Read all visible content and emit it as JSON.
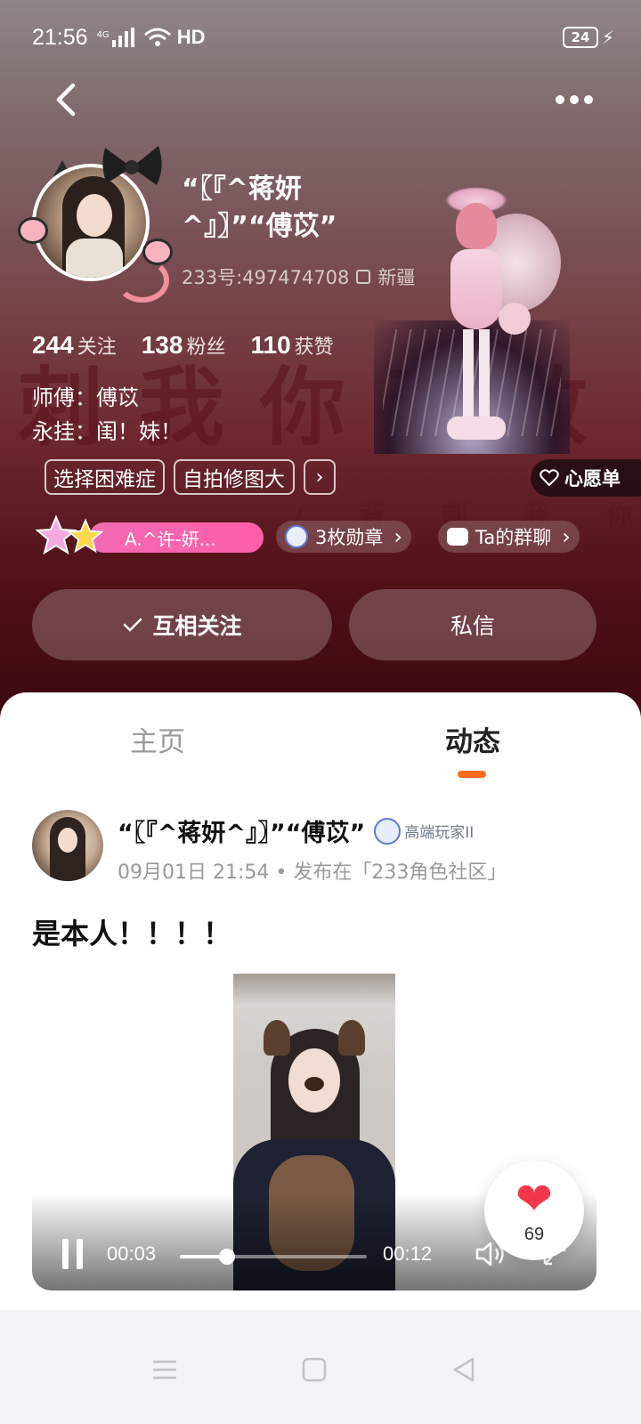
{
  "status_bar": {
    "time": "21:56",
    "network_tag": "4G",
    "hd_label": "HD",
    "battery": "24"
  },
  "background_text": {
    "big": "刺我你无敌",
    "small": "/ 背 刺 我 你 无 敌"
  },
  "profile": {
    "name_line1": "“〖『^蒋妍",
    "name_line2": "^』〗”“傅苡”",
    "uid": "233号:497474708",
    "location": "新疆",
    "stats": [
      {
        "value": "244",
        "label": "关注"
      },
      {
        "value": "138",
        "label": "粉丝"
      },
      {
        "value": "110",
        "label": "获赞"
      }
    ],
    "bio_line1": "师傅：傅苡",
    "bio_line2": "永挂：闺！妹！",
    "tags": [
      "选择困难症",
      "自拍修图大"
    ],
    "tags_more": "›",
    "wishlist": "心愿单",
    "vip_chip": "A.^许-妍...",
    "medal_chip": "3枚勋章",
    "group_chip": "Ta的群聊",
    "chip_arrow": "›",
    "follow_button": "互相关注",
    "message_button": "私信"
  },
  "tabs": {
    "home": "主页",
    "feed": "动态"
  },
  "post": {
    "author": "“〖『^蒋妍^』〗”“傅苡”",
    "badge": "高端玩家II",
    "meta": "09月01日 21:54 • 发布在「233角色社区」",
    "text": "是本人！！！！",
    "video": {
      "current_time": "00:03",
      "total_time": "00:12",
      "progress": 0.25
    },
    "likes": "69"
  },
  "colors": {
    "accent": "#ff6b1a",
    "like": "#f0374c",
    "vip_pink": "#f26ab4"
  },
  "icons": [
    "back-arrow-icon",
    "more-icon",
    "copy-icon",
    "heart-outline-icon",
    "check-icon",
    "medal-icon",
    "chat-icon",
    "pause-icon",
    "volume-icon",
    "fullscreen-icon",
    "heart-icon",
    "menu-icon",
    "home-square-icon",
    "back-triangle-icon"
  ]
}
